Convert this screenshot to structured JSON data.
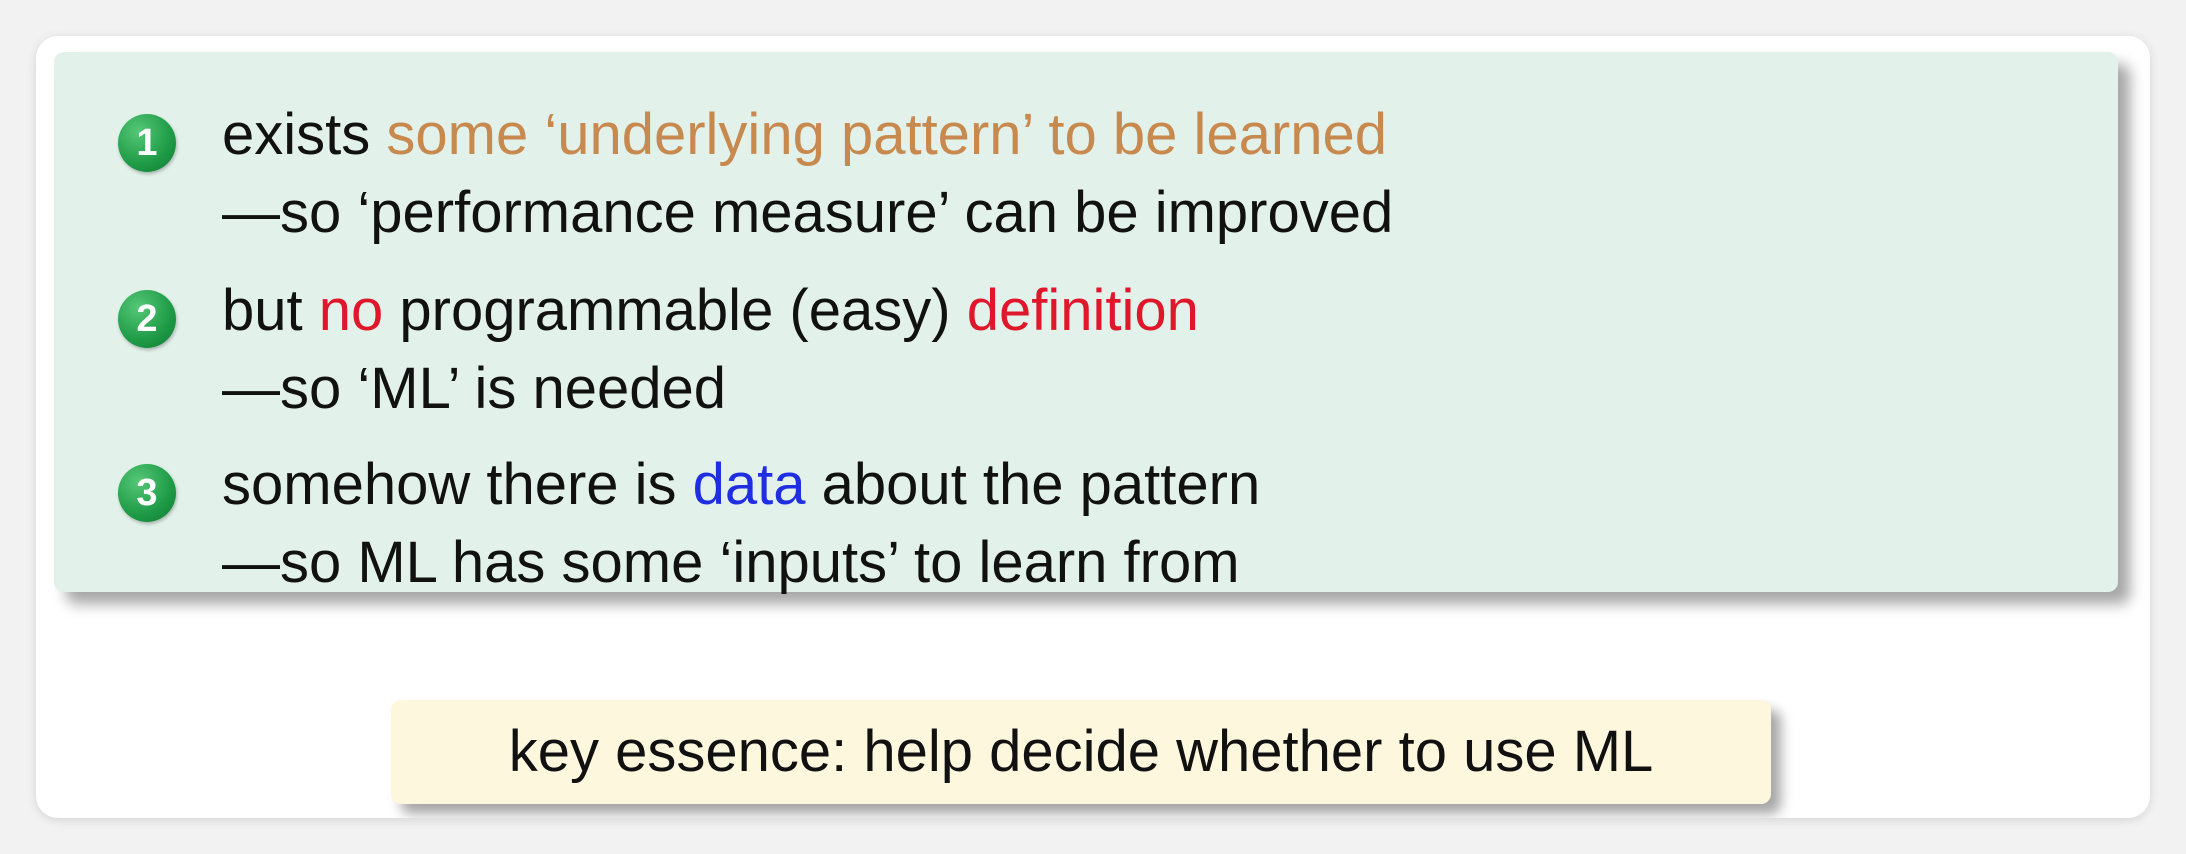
{
  "items": [
    {
      "number": "1",
      "line1": [
        {
          "text": "exists ",
          "style": "normal"
        },
        {
          "text": "some ‘underlying pattern’ to be learned",
          "style": "orange"
        }
      ],
      "line2": "—so ‘performance measure’ can be improved"
    },
    {
      "number": "2",
      "line1": [
        {
          "text": "but ",
          "style": "normal"
        },
        {
          "text": "no",
          "style": "red"
        },
        {
          "text": " programmable (easy) ",
          "style": "normal"
        },
        {
          "text": "definition",
          "style": "red"
        }
      ],
      "line2": "—so ‘ML’ is needed"
    },
    {
      "number": "3",
      "line1": [
        {
          "text": "somehow there is ",
          "style": "normal"
        },
        {
          "text": "data",
          "style": "blue"
        },
        {
          "text": " about the pattern",
          "style": "normal"
        }
      ],
      "line2": "—so ML has some ‘inputs’ to learn from"
    }
  ],
  "key_essence": "key essence: help decide whether to use ML",
  "colors": {
    "panel_bg": "#e2f1ea",
    "badge_green": "#1e9a46",
    "orange_text": "#c8894f",
    "red_text": "#e0162a",
    "blue_text": "#1f2ee0",
    "key_box_bg": "#fdf7de"
  }
}
